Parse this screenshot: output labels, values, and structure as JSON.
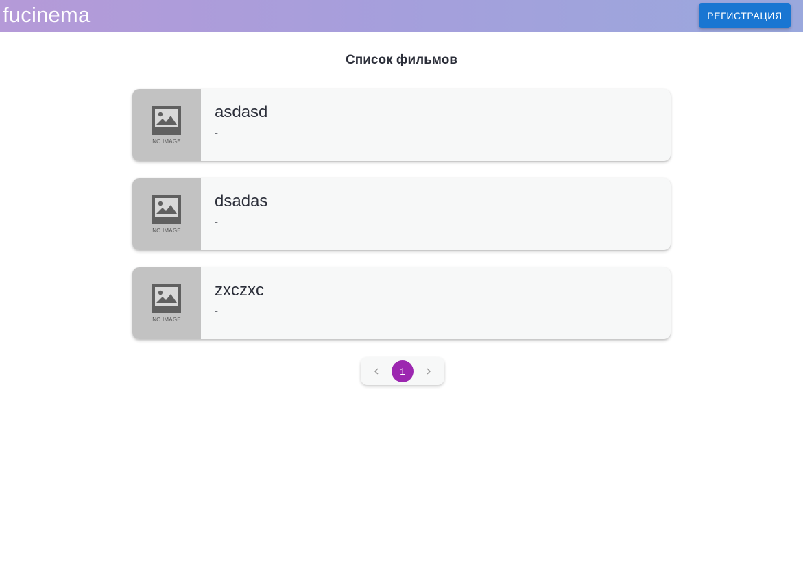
{
  "header": {
    "logo": "fucinema",
    "register_label": "РЕГИСТРАЦИЯ"
  },
  "main": {
    "title": "Список фильмов",
    "films": [
      {
        "title": "asdasd",
        "description": "-",
        "poster_label": "NO IMAGE"
      },
      {
        "title": "dsadas",
        "description": "-",
        "poster_label": "NO IMAGE"
      },
      {
        "title": "zxczxc",
        "description": "-",
        "poster_label": "NO IMAGE"
      }
    ]
  },
  "pagination": {
    "current_page": "1",
    "prev_icon": "chevron-left-icon",
    "next_icon": "chevron-right-icon"
  },
  "colors": {
    "register_button": "#1976d2",
    "active_page": "#9c27b0",
    "poster_placeholder": "#c2c2c2"
  }
}
